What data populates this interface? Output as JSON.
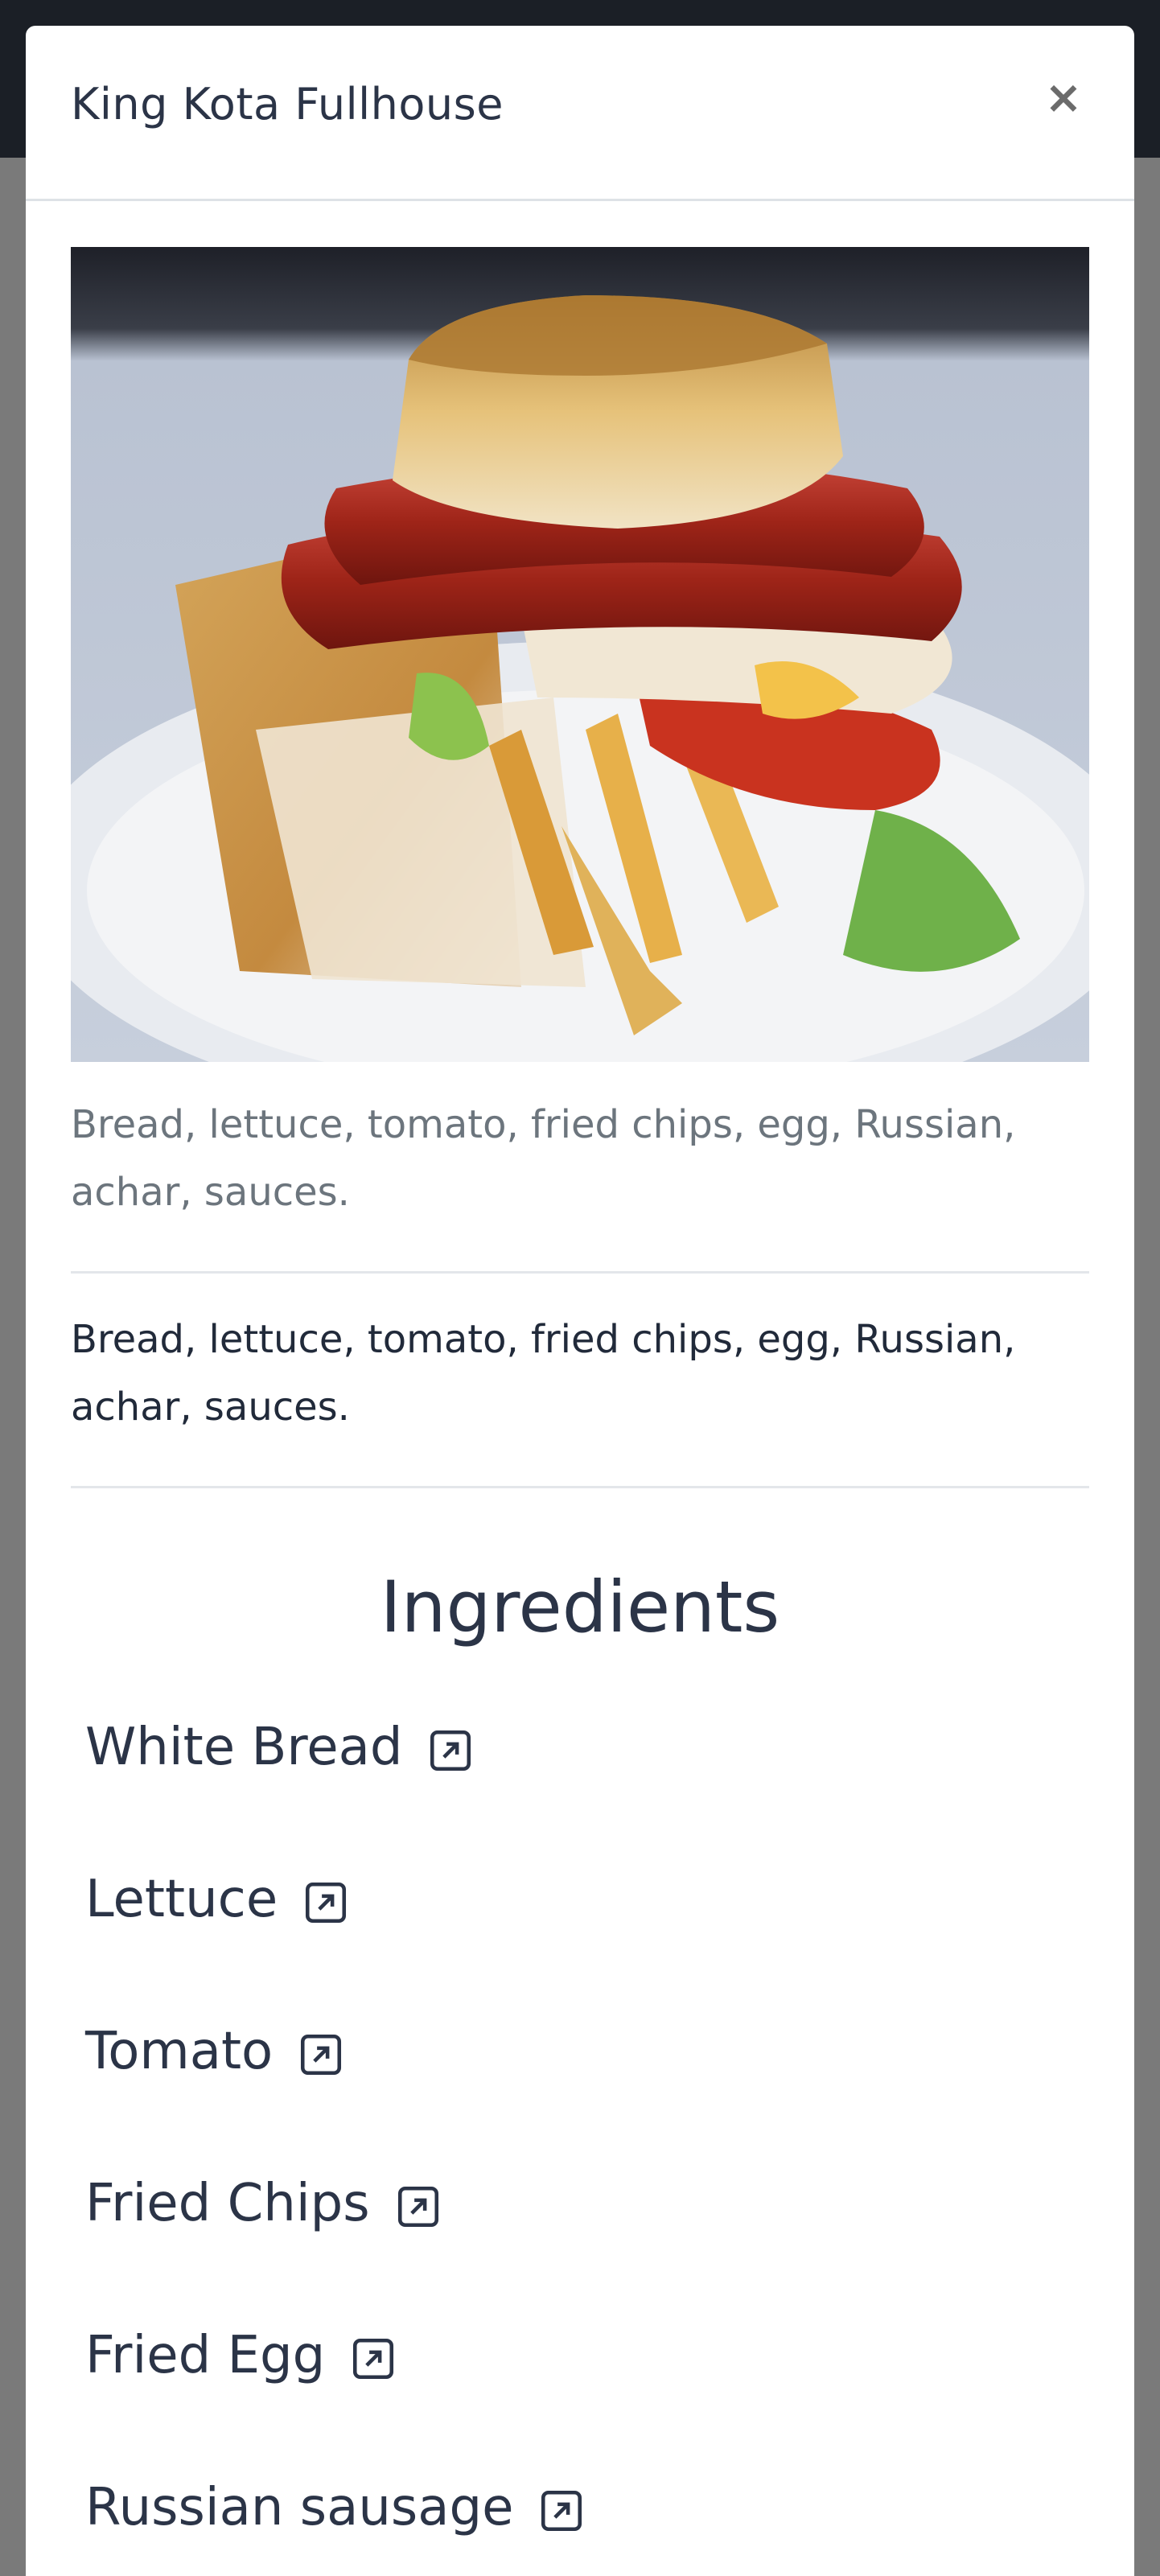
{
  "modal": {
    "title": "King Kota Fullhouse",
    "close_label": "×"
  },
  "image": {
    "alt": "King Kota Fullhouse"
  },
  "caption": "Bread, lettuce, tomato, fried chips, egg, Russian, achar, sauces.",
  "description": "Bread, lettuce, tomato, fried chips, egg, Russian, achar, sauces.",
  "ingredients": {
    "heading": "Ingredients",
    "items": [
      {
        "label": "White Bread",
        "icon": "external-link-icon"
      },
      {
        "label": "Lettuce",
        "icon": "external-link-icon"
      },
      {
        "label": "Tomato",
        "icon": "external-link-icon"
      },
      {
        "label": "Fried Chips",
        "icon": "external-link-icon"
      },
      {
        "label": "Fried Egg",
        "icon": "external-link-icon"
      },
      {
        "label": "Russian sausage",
        "icon": "external-link-icon"
      }
    ]
  },
  "colors": {
    "backdrop": "#7a7a7a",
    "navbar": "#1b1f26",
    "title_text": "#2b3447",
    "muted_text": "#6c757d"
  }
}
